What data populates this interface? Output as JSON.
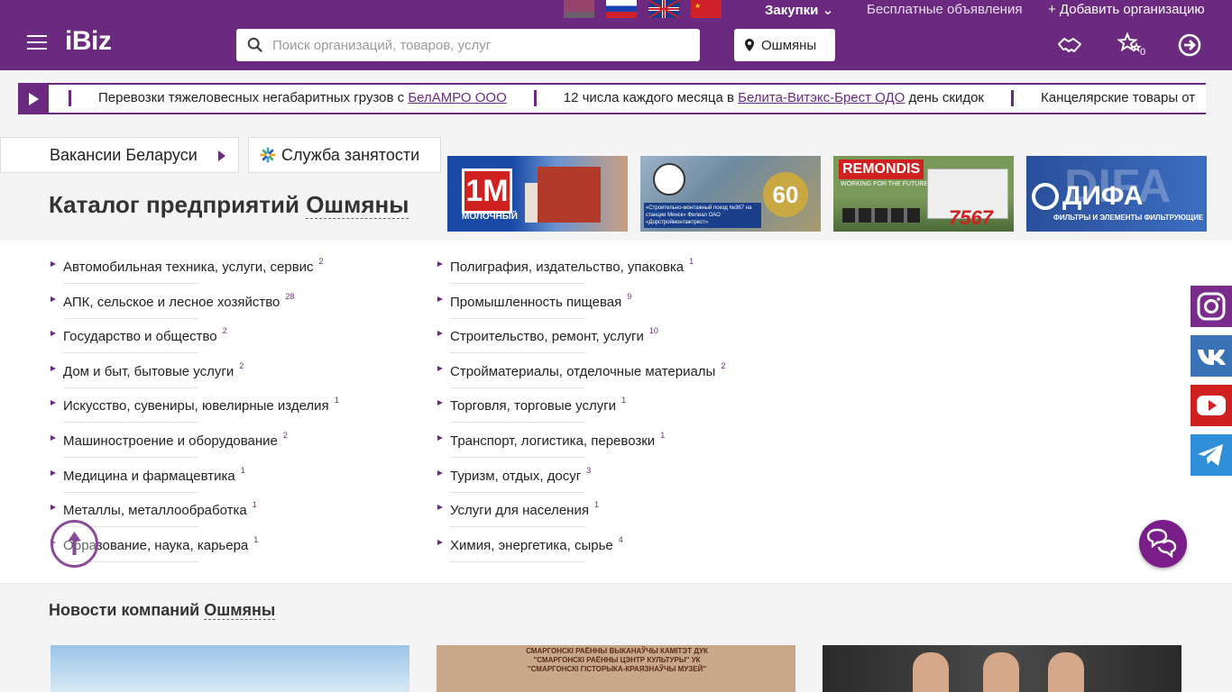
{
  "topbar": {
    "flags": [
      "by-flag",
      "ru-flag",
      "gb-flag",
      "cn-flag"
    ],
    "purchases_label": "Закупки",
    "ads_label": "Бесплатные объявления",
    "add_org_label": "+ Добавить организацию"
  },
  "header": {
    "logo": "iBiz",
    "search_placeholder": "Поиск организаций, товаров, услуг",
    "city": "Ошмяны",
    "favorites_count": "0",
    "colors": {
      "brand": "#6b2a80"
    }
  },
  "ticker": {
    "items": [
      {
        "before": "Перевозки тяжеловесных негабаритных грузов с ",
        "link": "БелАМРО ООО",
        "after": ""
      },
      {
        "before": "12 числа каждого месяца в ",
        "link": "Белита-Витэкс-Брест ОДО",
        "after": " день скидок"
      },
      {
        "before": "Канцелярские товары от",
        "link": "",
        "after": ""
      }
    ]
  },
  "tabs": {
    "vacancies": "Вакансии Беларуси",
    "employment": "Служба занятости"
  },
  "catalog": {
    "title": "Каталог предприятий",
    "city": "Ошмяны",
    "left": [
      {
        "label": "Автомобильная техника, услуги, сервис",
        "count": "2"
      },
      {
        "label": "АПК, сельское и лесное хозяйство",
        "count": "28"
      },
      {
        "label": "Государство и общество",
        "count": "2"
      },
      {
        "label": "Дом и быт, бытовые услуги",
        "count": "2"
      },
      {
        "label": "Искусство, сувениры, ювелирные изделия",
        "count": "1"
      },
      {
        "label": "Машиностроение и оборудование",
        "count": "2"
      },
      {
        "label": "Медицина и фармацевтика",
        "count": "1"
      },
      {
        "label": "Металлы, металлообработка",
        "count": "1"
      },
      {
        "label": "Образование, наука, карьера",
        "count": "1"
      }
    ],
    "right": [
      {
        "label": "Полиграфия, издательство, упаковка",
        "count": "1"
      },
      {
        "label": "Промышленность пищевая",
        "count": "9"
      },
      {
        "label": "Строительство, ремонт, услуги",
        "count": "10"
      },
      {
        "label": "Стройматериалы, отделочные материалы",
        "count": "2"
      },
      {
        "label": "Торговля, торговые услуги",
        "count": "1"
      },
      {
        "label": "Транспорт, логистика, перевозки",
        "count": "1"
      },
      {
        "label": "Туризм, отдых, досуг",
        "count": "3"
      },
      {
        "label": "Услуги для населения",
        "count": "1"
      },
      {
        "label": "Химия, энергетика, сырье",
        "count": "4"
      }
    ]
  },
  "banners": {
    "b1": {
      "logo": "1M",
      "text": "МОЛОЧНЫЙ"
    },
    "b2": {
      "caption": "«Строительно-монтажный поезд №367 на станции Минск» Филиал ОАО «Дорстроймонтажтрест»",
      "anniv": "60"
    },
    "b3": {
      "brand": "REMONDIS",
      "tagline": "WORKING FOR THE FUTURE",
      "number": "7567"
    },
    "b4": {
      "ghost": "DIFA",
      "name": "ДИФА",
      "sub": "ФИЛЬТРЫ И ЭЛЕМЕНТЫ ФИЛЬТРУЮЩИЕ"
    }
  },
  "news": {
    "title": "Новости компаний",
    "city": "Ошмяны",
    "n2_text": "СМАРГОНСКІ РАЁННЫ ВЫКАНАЎЧЫ КАМІТЭТ ДУК \"СМАРГОНСКІ РАЁННЫ ЦЭНТР КУЛЬТУРЫ\" УК \"СМАРГОНСКІ ГІСТОРЫКА-КРАЯЗНАЎЧЫ МУЗЕЙ\""
  },
  "social": [
    "instagram-icon",
    "vk-icon",
    "youtube-icon",
    "telegram-icon"
  ]
}
